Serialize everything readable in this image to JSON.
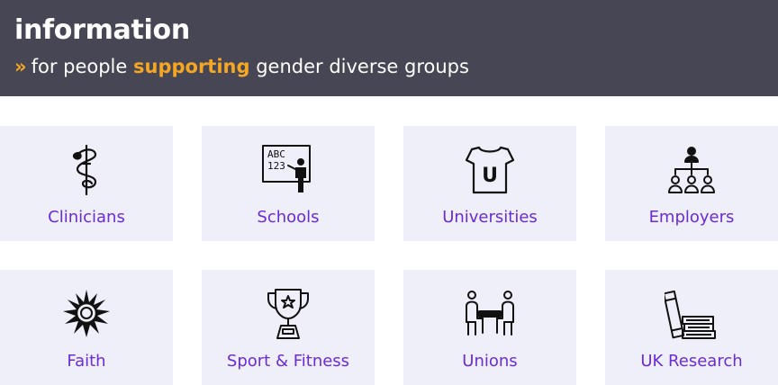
{
  "header": {
    "title": "information",
    "chevron": "»",
    "subtitle_before": "for people ",
    "subtitle_highlight": "supporting",
    "subtitle_after": " gender diverse groups"
  },
  "colors": {
    "banner_bg": "#464655",
    "accent": "#f5a623",
    "tile_bg": "#efeff9",
    "link": "#6a2bd9"
  },
  "tiles": [
    {
      "label": "Clinicians",
      "icon": "caduceus-icon"
    },
    {
      "label": "Schools",
      "icon": "teacher-blackboard-icon",
      "icon_text_1": "ABC",
      "icon_text_2": "123"
    },
    {
      "label": "Universities",
      "icon": "university-tshirt-icon",
      "icon_text": "U"
    },
    {
      "label": "Employers",
      "icon": "org-chart-icon"
    },
    {
      "label": "Faith",
      "icon": "sun-icon"
    },
    {
      "label": "Sport & Fitness",
      "icon": "trophy-icon"
    },
    {
      "label": "Unions",
      "icon": "meeting-table-icon"
    },
    {
      "label": "UK Research",
      "icon": "books-icon"
    }
  ]
}
